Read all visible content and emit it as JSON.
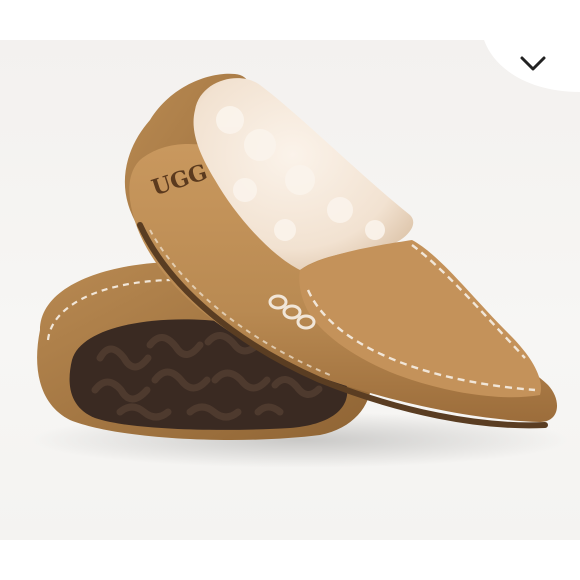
{
  "photo": {
    "subject": "product-photo-moccasin-slippers",
    "logo_text": "UGG",
    "colors": {
      "suede": "#b98a52",
      "suede_shadow": "#8f6434",
      "suede_light": "#cfa06a",
      "fleece": "#f6e9dc",
      "fleece_shadow": "#e6d3c0",
      "sole": "#3a2a22",
      "stitch": "#f1e6d8",
      "background": "#f4f2f0"
    }
  },
  "overlay": {
    "collapse_icon": "chevron-down-icon",
    "background": "#ffffff",
    "icon_color": "#222222"
  }
}
